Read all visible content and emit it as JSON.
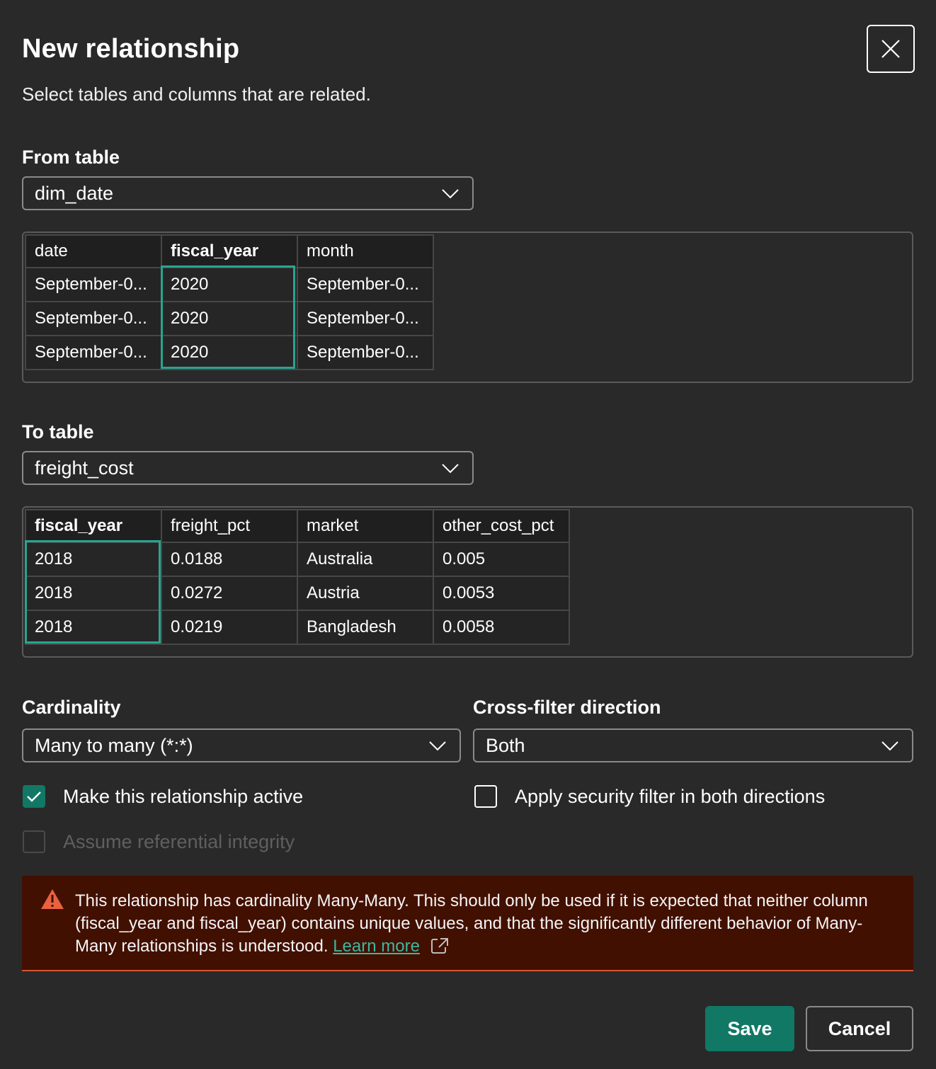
{
  "dialog": {
    "title": "New relationship",
    "subtitle": "Select tables and columns that are related.",
    "close_icon": "close-icon"
  },
  "from_table": {
    "label": "From table",
    "selected": "dim_date",
    "preview": {
      "columns": [
        "date",
        "fiscal_year",
        "month"
      ],
      "selected_column": "fiscal_year",
      "rows": [
        [
          "September-0...",
          "2020",
          "September-0..."
        ],
        [
          "September-0...",
          "2020",
          "September-0..."
        ],
        [
          "September-0...",
          "2020",
          "September-0..."
        ]
      ]
    }
  },
  "to_table": {
    "label": "To table",
    "selected": "freight_cost",
    "preview": {
      "columns": [
        "fiscal_year",
        "freight_pct",
        "market",
        "other_cost_pct"
      ],
      "selected_column": "fiscal_year",
      "rows": [
        [
          "2018",
          "0.0188",
          "Australia",
          "0.005"
        ],
        [
          "2018",
          "0.0272",
          "Austria",
          "0.0053"
        ],
        [
          "2018",
          "0.0219",
          "Bangladesh",
          "0.0058"
        ]
      ]
    }
  },
  "cardinality": {
    "label": "Cardinality",
    "selected": "Many to many (*:*)"
  },
  "cross_filter": {
    "label": "Cross-filter direction",
    "selected": "Both"
  },
  "options": {
    "make_active": {
      "label": "Make this relationship active",
      "checked": true
    },
    "security_filter": {
      "label": "Apply security filter in both directions",
      "checked": false
    },
    "referential_integrity": {
      "label": "Assume referential integrity",
      "checked": false,
      "disabled": true
    }
  },
  "warning": {
    "icon": "warning-icon",
    "text": "This relationship has cardinality Many-Many. This should only be used if it is expected that neither column (fiscal_year and fiscal_year) contains unique values, and that the significantly different behavior of Many-Many relationships is understood.",
    "link": "Learn more",
    "link_icon": "external-link-icon"
  },
  "buttons": {
    "save": "Save",
    "cancel": "Cancel"
  },
  "colors": {
    "accent": "#117865",
    "selection": "#2aa38f",
    "warning_bg": "#421001",
    "warning_icon": "#e8623f"
  }
}
